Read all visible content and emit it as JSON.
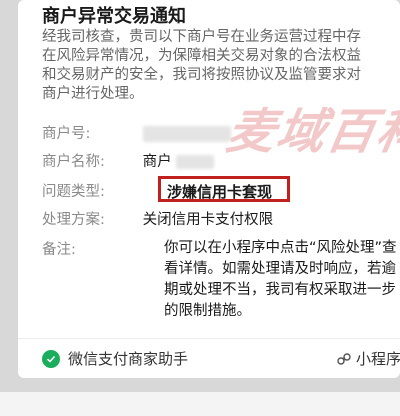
{
  "notice": {
    "title": "商户异常交易通知",
    "intro_lines": [
      "经我司核查，贵司以下商户号在业务运营过程中存",
      "在风险异常情况，为保障相关交易对象的合法权益",
      "和交易财产的安全，我司将按照协议及监管要求对",
      "商户进行处理。"
    ],
    "merchant_id_label": "商户号:",
    "merchant_name_label": "商户名称:",
    "merchant_name_value": "商户",
    "problem_type_label": "问题类型:",
    "problem_type_value": "涉嫌信用卡套现",
    "solution_label": "处理方案:",
    "solution_value": "关闭信用卡支付权限",
    "remark_label": "备注:",
    "remark_lines": [
      "你可以在小程序中点击“风险处理”查",
      "看详情。如需处理请及时响应，若逾",
      "期或处理不当，我司有权采取进一步",
      "的限制措施。"
    ]
  },
  "footer": {
    "app_name": "微信支付商家助手",
    "mini_program_label": "小程序"
  },
  "watermark_text": "麦域百科"
}
